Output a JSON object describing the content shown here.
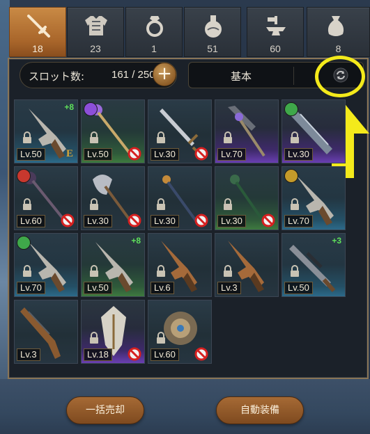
{
  "tabs": [
    {
      "name": "weapon",
      "icon": "sword-icon",
      "count": "18",
      "active": true
    },
    {
      "name": "armor",
      "icon": "armor-icon",
      "count": "23",
      "active": false
    },
    {
      "name": "accessory",
      "icon": "ring-icon",
      "count": "1",
      "active": false
    },
    {
      "name": "consumable",
      "icon": "potion-icon",
      "count": "51",
      "active": false
    },
    {
      "name": "material",
      "icon": "anvil-icon",
      "count": "60",
      "active": false
    },
    {
      "name": "misc",
      "icon": "bag-icon",
      "count": "8",
      "active": false
    }
  ],
  "slots": {
    "label": "スロット数:",
    "value": "161 / 250",
    "expand_label": "+"
  },
  "sort": {
    "label": "基本",
    "refresh_icon": "refresh-icon"
  },
  "highlight": {
    "color": "#f4ea1b"
  },
  "items": [
    {
      "level": "Lv.50",
      "rarity": "blue",
      "kind": "revolver",
      "plus": "+8",
      "locked": true,
      "mark": "E",
      "badge": null,
      "banned": false
    },
    {
      "level": "Lv.50",
      "rarity": "green",
      "kind": "staff",
      "plus": null,
      "locked": true,
      "mark": null,
      "badge": "purple",
      "banned": true
    },
    {
      "level": "Lv.30",
      "rarity": "none",
      "kind": "sword",
      "plus": null,
      "locked": true,
      "mark": null,
      "badge": null,
      "banned": true
    },
    {
      "level": "Lv.70",
      "rarity": "purple",
      "kind": "spiked-club",
      "plus": null,
      "locked": true,
      "mark": null,
      "badge": null,
      "banned": false
    },
    {
      "level": "Lv.30",
      "rarity": "purple",
      "kind": "cannon",
      "plus": null,
      "locked": true,
      "mark": null,
      "badge": "green",
      "banned": false
    },
    {
      "level": "Lv.60",
      "rarity": "none",
      "kind": "dark-staff",
      "plus": null,
      "locked": true,
      "mark": null,
      "badge": "red",
      "banned": true
    },
    {
      "level": "Lv.30",
      "rarity": "none",
      "kind": "axe",
      "plus": null,
      "locked": true,
      "mark": null,
      "badge": null,
      "banned": true
    },
    {
      "level": "Lv.30",
      "rarity": "none",
      "kind": "wand",
      "plus": null,
      "locked": true,
      "mark": null,
      "badge": null,
      "banned": true
    },
    {
      "level": "Lv.30",
      "rarity": "green",
      "kind": "green-staff",
      "plus": null,
      "locked": true,
      "mark": null,
      "badge": null,
      "banned": true
    },
    {
      "level": "Lv.70",
      "rarity": "blue",
      "kind": "revolver",
      "plus": null,
      "locked": true,
      "mark": null,
      "badge": "gold",
      "banned": false
    },
    {
      "level": "Lv.70",
      "rarity": "blue",
      "kind": "revolver",
      "plus": null,
      "locked": true,
      "mark": null,
      "badge": "green",
      "banned": false
    },
    {
      "level": "Lv.50",
      "rarity": "green",
      "kind": "revolver",
      "plus": "+8",
      "locked": true,
      "mark": null,
      "badge": null,
      "banned": false
    },
    {
      "level": "Lv.6",
      "rarity": "none",
      "kind": "brown-revolver",
      "plus": null,
      "locked": true,
      "mark": null,
      "badge": null,
      "banned": false
    },
    {
      "level": "Lv.3",
      "rarity": "none",
      "kind": "brown-revolver",
      "plus": null,
      "locked": true,
      "mark": null,
      "badge": null,
      "banned": false
    },
    {
      "level": "Lv.50",
      "rarity": "blue",
      "kind": "rifle-scope",
      "plus": "+3",
      "locked": true,
      "mark": null,
      "badge": null,
      "banned": false
    },
    {
      "level": "Lv.3",
      "rarity": "none",
      "kind": "rifle",
      "plus": null,
      "locked": false,
      "mark": null,
      "badge": null,
      "banned": false
    },
    {
      "level": "Lv.18",
      "rarity": "purple",
      "kind": "shield-tall",
      "plus": null,
      "locked": true,
      "mark": null,
      "badge": null,
      "banned": true
    },
    {
      "level": "Lv.60",
      "rarity": "none",
      "kind": "shield-round",
      "plus": null,
      "locked": true,
      "mark": null,
      "badge": null,
      "banned": true
    }
  ],
  "buttons": {
    "bulk_sell": "一括売却",
    "auto_equip": "自動装備"
  }
}
